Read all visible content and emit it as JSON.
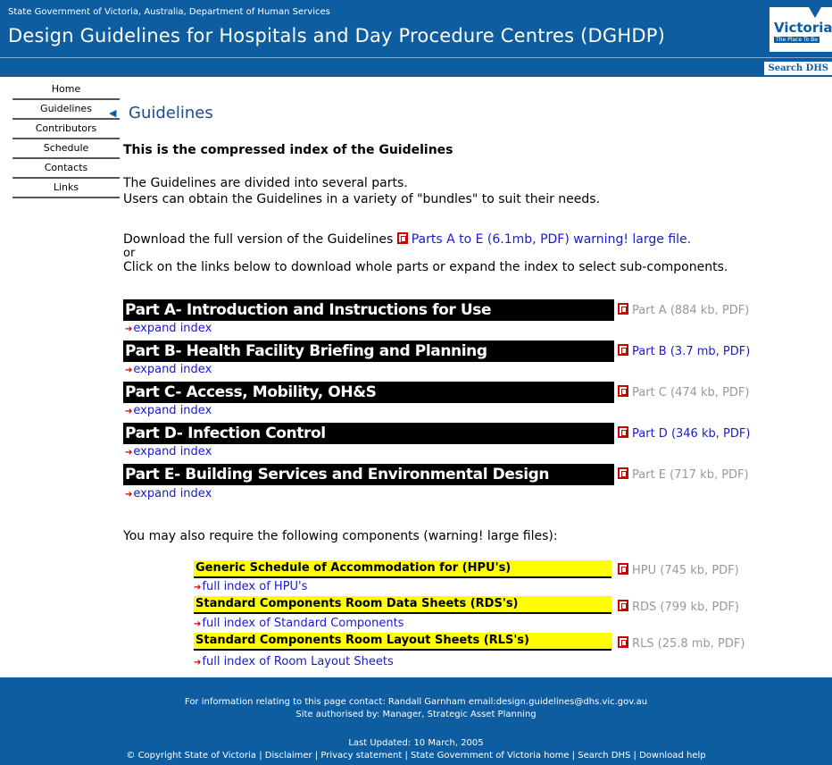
{
  "header": {
    "department": "State Government of Victoria, Australia, Department of Human Services",
    "title": "Design Guidelines for Hospitals and Day Procedure Centres (DGHDP)",
    "logo_text": "Victoria",
    "logo_tagline": "The Place To Be",
    "search_label": "Search DHS"
  },
  "nav": {
    "items": [
      "Home",
      "Guidelines",
      "Contributors",
      "Schedule",
      "Contacts",
      "Links"
    ]
  },
  "main": {
    "heading": "Guidelines",
    "intro_bold": "This is the compressed index of the Guidelines",
    "intro_line1": "The Guidelines are divided into several parts.",
    "intro_line2": "Users can obtain the Guidelines in a variety of \"bundles\" to suit their needs.",
    "download_text": "Download the full version of the Guidelines",
    "download_link": "Parts A to E (6.1mb, PDF) warning! large file.",
    "or_text": "or",
    "click_text": "Click on the links below to download whole parts or expand the index to select sub-components.",
    "expand_label": "expand index",
    "parts": [
      {
        "title": "Part A- Introduction and Instructions for Use",
        "link": "Part A (884 kb, PDF)"
      },
      {
        "title": "Part B- Health Facility Briefing and Planning",
        "link": "Part B (3.7 mb, PDF)"
      },
      {
        "title": "Part C- Access, Mobility, OH&S",
        "link": "Part C (474 kb, PDF)"
      },
      {
        "title": "Part D- Infection Control",
        "link": "Part D (346 kb, PDF)"
      },
      {
        "title": "Part E- Building Services and Environmental Design",
        "link": "Part E (717 kb, PDF)"
      }
    ],
    "components_intro": "You may also require the following components (warning! large files):",
    "components": [
      {
        "title": "Generic Schedule of Accommodation for (HPU's)",
        "link": "HPU (745 kb, PDF)",
        "index": "full index of HPU's"
      },
      {
        "title": "Standard Components Room Data Sheets (RDS's)",
        "link": "RDS (799 kb, PDF)",
        "index": "full index of Standard Components"
      },
      {
        "title": "Standard Components Room Layout Sheets (RLS's)",
        "link": "RLS (25.8 mb, PDF)",
        "index": "full index of Room Layout Sheets"
      }
    ]
  },
  "footer": {
    "contact": "For information relating to this page contact: Randall Garnham email:design.guidelines@dhs.vic.gov.au",
    "authorised": "Site authorised by: Manager, Strategic Asset Planning",
    "updated": "Last Updated: 10 March, 2005",
    "copyright": "© Copyright State of Victoria",
    "links": [
      "Disclaimer",
      "Privacy statement",
      "State Government of Victoria home",
      "Search DHS",
      "Download help"
    ]
  },
  "colors": {
    "header_blue": "#0d5da0",
    "component_yellow": "#ffff00",
    "part_black": "#000000",
    "link_blue": "#1a1acc"
  }
}
